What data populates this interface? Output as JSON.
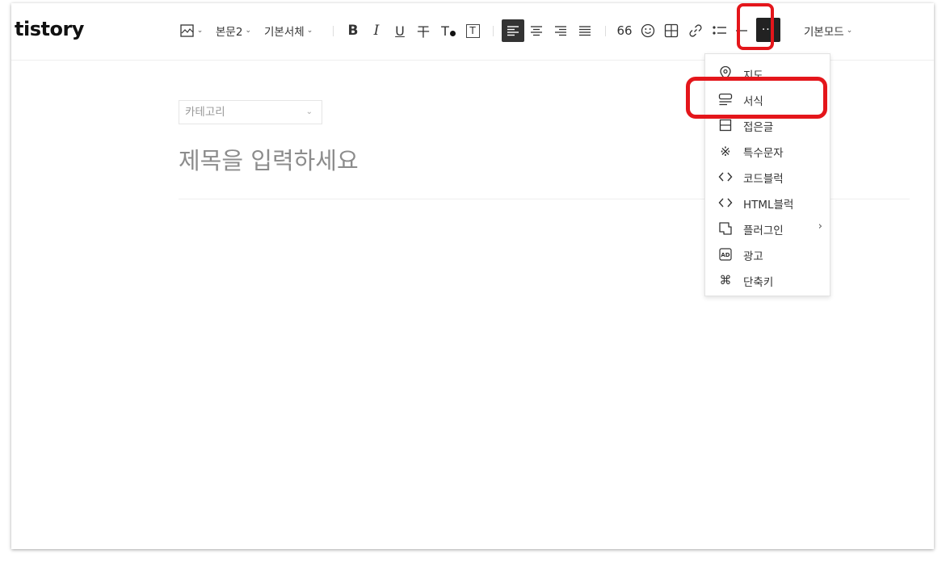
{
  "app": {
    "logo": "tistory"
  },
  "toolbar": {
    "image_icon": "image-icon",
    "paragraph_style": "본문2",
    "font_family": "기본서체",
    "bold": "B",
    "italic": "I",
    "underline": "U",
    "strikethrough": "干",
    "text_color": "T",
    "background_color": "T",
    "quote": "66",
    "emoticon_icon": "smile-icon",
    "table_icon": "table-icon",
    "link_icon": "link-icon",
    "list_icon": "list-icon",
    "hr_icon": "divider-icon",
    "more": "···",
    "mode": "기본모드"
  },
  "editor": {
    "category_placeholder": "카테고리",
    "title_placeholder": "제목을 입력하세요"
  },
  "more_menu": {
    "items": [
      {
        "label": "지도",
        "icon": "map-pin-icon"
      },
      {
        "label": "서식",
        "icon": "template-icon"
      },
      {
        "label": "접은글",
        "icon": "fold-icon"
      },
      {
        "label": "특수문자",
        "icon": "special-char-icon"
      },
      {
        "label": "코드블럭",
        "icon": "code-icon"
      },
      {
        "label": "HTML블럭",
        "icon": "html-icon"
      },
      {
        "label": "플러그인",
        "icon": "plugin-icon"
      },
      {
        "label": "광고",
        "icon": "ad-icon"
      },
      {
        "label": "단축키",
        "icon": "command-icon"
      }
    ],
    "submenu_arrow": "›"
  },
  "colors": {
    "highlight": "#e4161b",
    "active_button": "#222222"
  }
}
